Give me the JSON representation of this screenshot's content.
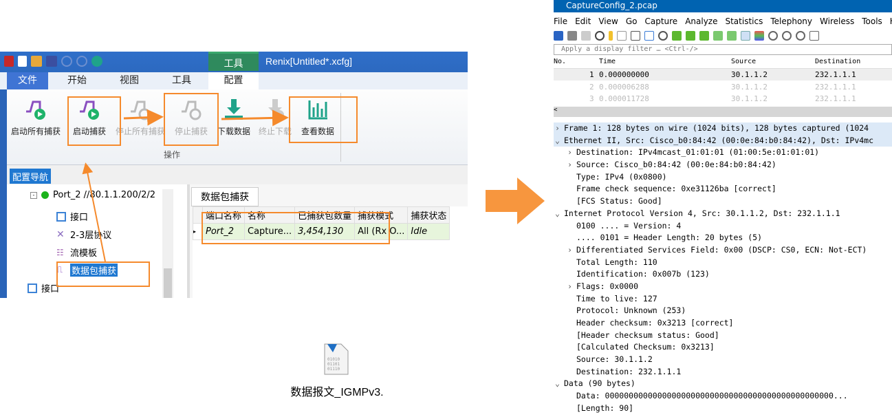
{
  "renix": {
    "window_title": "Renix[Untitled*.xcfg]",
    "context_tab": "工具",
    "tabs": [
      "文件",
      "开始",
      "视图",
      "工具",
      "配置"
    ],
    "ribbon_buttons": [
      {
        "label": "启动所有捕获",
        "enabled": true,
        "icon": "start-capture-icon"
      },
      {
        "label": "启动捕获",
        "enabled": true,
        "icon": "start-capture-icon"
      },
      {
        "label": "停止所有捕获",
        "enabled": false,
        "icon": "stop-capture-icon"
      },
      {
        "label": "停止捕获",
        "enabled": false,
        "icon": "stop-capture-icon"
      },
      {
        "label": "下载数据",
        "enabled": true,
        "icon": "download-icon"
      },
      {
        "label": "终止下载",
        "enabled": false,
        "icon": "cancel-download-icon"
      },
      {
        "label": "查看数据",
        "enabled": true,
        "icon": "bar-chart-icon"
      }
    ],
    "group_label": "操作",
    "nav_title": "配置导航",
    "tree": {
      "port": "Port_2 //80.1.1.200/2/2",
      "items": [
        "接口",
        "2-3层协议",
        "流模板",
        "数据包捕获"
      ],
      "next": "接口"
    },
    "pane_tab": "数据包捕获",
    "columns": [
      "端口名称",
      "名称",
      "已捕获包数量",
      "捕获模式",
      "捕获状态"
    ],
    "row": [
      "Port_2",
      "Capture...",
      "3,454,130",
      "All (Rx O...",
      "Idle"
    ],
    "accent": "#f58a2c"
  },
  "file": {
    "label": "数据报文_IGMPv3."
  },
  "wireshark": {
    "title": "CaptureConfig_2.pcap",
    "menu": [
      "File",
      "Edit",
      "View",
      "Go",
      "Capture",
      "Analyze",
      "Statistics",
      "Telephony",
      "Wireless",
      "Tools",
      "Help"
    ],
    "filter_placeholder": "Apply a display filter … <Ctrl-/>",
    "columns": [
      "No.",
      "Time",
      "Source",
      "Destination"
    ],
    "packets": [
      [
        "1",
        "0.000000000",
        "30.1.1.2",
        "232.1.1.1"
      ],
      [
        "2",
        "0.000006288",
        "30.1.1.2",
        "232.1.1.1"
      ],
      [
        "3",
        "0.000011728",
        "30.1.1.2",
        "232.1.1.1"
      ]
    ],
    "details": [
      {
        "t": "Frame 1: 128 bytes on wire (1024 bits), 128 bytes captured (1024",
        "m": ">",
        "i": 0,
        "s": true
      },
      {
        "t": "Ethernet II, Src: Cisco_b0:84:42 (00:0e:84:b0:84:42), Dst: IPv4mc",
        "m": "v",
        "i": 0,
        "s": true
      },
      {
        "t": "Destination: IPv4mcast_01:01:01 (01:00:5e:01:01:01)",
        "m": ">",
        "i": 1
      },
      {
        "t": "Source: Cisco_b0:84:42 (00:0e:84:b0:84:42)",
        "m": ">",
        "i": 1
      },
      {
        "t": "Type: IPv4 (0x0800)",
        "m": "",
        "i": 1
      },
      {
        "t": "Frame check sequence: 0xe31126ba [correct]",
        "m": "",
        "i": 1
      },
      {
        "t": "[FCS Status: Good]",
        "m": "",
        "i": 1
      },
      {
        "t": "Internet Protocol Version 4, Src: 30.1.1.2, Dst: 232.1.1.1",
        "m": "v",
        "i": 0
      },
      {
        "t": "0100 .... = Version: 4",
        "m": "",
        "i": 1
      },
      {
        "t": ".... 0101 = Header Length: 20 bytes (5)",
        "m": "",
        "i": 1
      },
      {
        "t": "Differentiated Services Field: 0x00 (DSCP: CS0, ECN: Not-ECT)",
        "m": ">",
        "i": 1
      },
      {
        "t": "Total Length: 110",
        "m": "",
        "i": 1
      },
      {
        "t": "Identification: 0x007b (123)",
        "m": "",
        "i": 1
      },
      {
        "t": "Flags: 0x0000",
        "m": ">",
        "i": 1
      },
      {
        "t": "Time to live: 127",
        "m": "",
        "i": 1
      },
      {
        "t": "Protocol: Unknown (253)",
        "m": "",
        "i": 1
      },
      {
        "t": "Header checksum: 0x3213 [correct]",
        "m": "",
        "i": 1
      },
      {
        "t": "[Header checksum status: Good]",
        "m": "",
        "i": 1
      },
      {
        "t": "[Calculated Checksum: 0x3213]",
        "m": "",
        "i": 1
      },
      {
        "t": "Source: 30.1.1.2",
        "m": "",
        "i": 1
      },
      {
        "t": "Destination: 232.1.1.1",
        "m": "",
        "i": 1
      },
      {
        "t": "Data (90 bytes)",
        "m": "v",
        "i": 0
      },
      {
        "t": "Data: 000000000000000000000000000000000000000000000000...",
        "m": "",
        "i": 1
      },
      {
        "t": "[Length: 90]",
        "m": "",
        "i": 1
      }
    ]
  }
}
